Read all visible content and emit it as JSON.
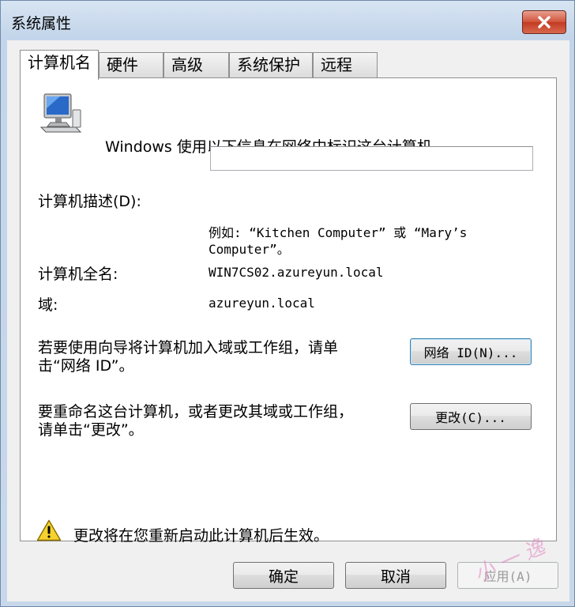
{
  "window": {
    "title": "系统属性"
  },
  "tabs": [
    {
      "label": "计算机名"
    },
    {
      "label": "硬件"
    },
    {
      "label": "高级"
    },
    {
      "label": "系统保护"
    },
    {
      "label": "远程"
    }
  ],
  "panel": {
    "intro": "Windows 使用以下信息在网络中标识这台计算机。",
    "description_label": "计算机描述(D):",
    "description_value": "",
    "example_line1": "例如: “Kitchen Computer” 或 “Mary’s",
    "example_line2": "Computer”。",
    "fullname_label": "计算机全名:",
    "fullname_value": "WIN7CS02.azureyun.local",
    "domain_label": "域:",
    "domain_value": "azureyun.local",
    "wizard_text_line1": "若要使用向导将计算机加入域或工作组，请单",
    "wizard_text_line2": "击“网络 ID”。",
    "network_id_button": "网络 ID(N)...",
    "rename_text_line1": "要重命名这台计算机，或者更改其域或工作组，",
    "rename_text_line2": "请单击“更改”。",
    "change_button": "更改(C)...",
    "warning_text": "更改将在您重新启动此计算机后生效。"
  },
  "footer": {
    "ok": "确定",
    "cancel": "取消",
    "apply": "应用(A)"
  },
  "watermark": {
    "text": "小 一 逸"
  },
  "colors": {
    "close_red": "#c23b22",
    "focus_blue": "#3c7fb1",
    "warning_yellow": "#f6d32c"
  }
}
